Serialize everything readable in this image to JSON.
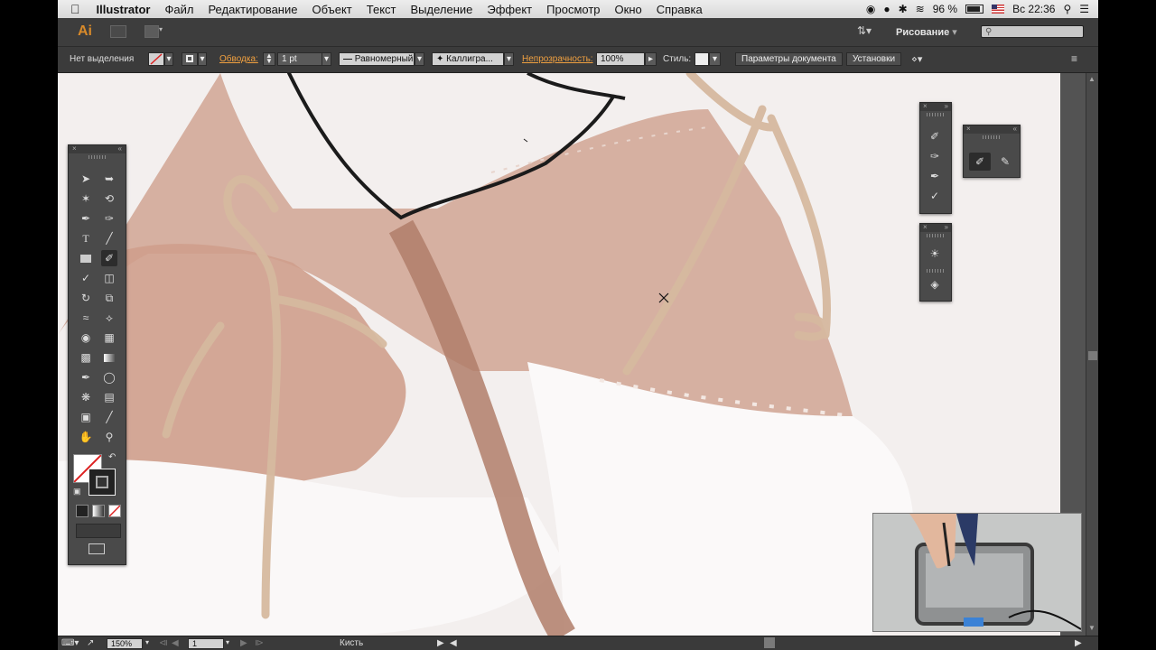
{
  "menubar": {
    "apple": "",
    "app_name": "Illustrator",
    "items": [
      "Файл",
      "Редактирование",
      "Объект",
      "Текст",
      "Выделение",
      "Эффект",
      "Просмотр",
      "Окно",
      "Справка"
    ],
    "battery": "96 %",
    "clock": "Вс 22:36"
  },
  "appbar": {
    "logo": "Ai",
    "workspace": "Рисование",
    "search_placeholder": ""
  },
  "control": {
    "selection": "Нет выделения",
    "stroke_label": "Обводка:",
    "stroke_weight": "1 pt",
    "profile": "Равномерный",
    "brush": "Каллигра...",
    "opacity_label": "Непрозрачность:",
    "opacity": "100%",
    "style_label": "Стиль:",
    "doc_setup": "Параметры документа",
    "preferences": "Установки"
  },
  "status": {
    "zoom": "150%",
    "page": "1",
    "tool_name": "Кисть"
  },
  "colors": {
    "accent": "#d88a2a",
    "canvas_bg": "#f2eeee",
    "leather": "#b57a62",
    "lace": "#c9a98c"
  }
}
